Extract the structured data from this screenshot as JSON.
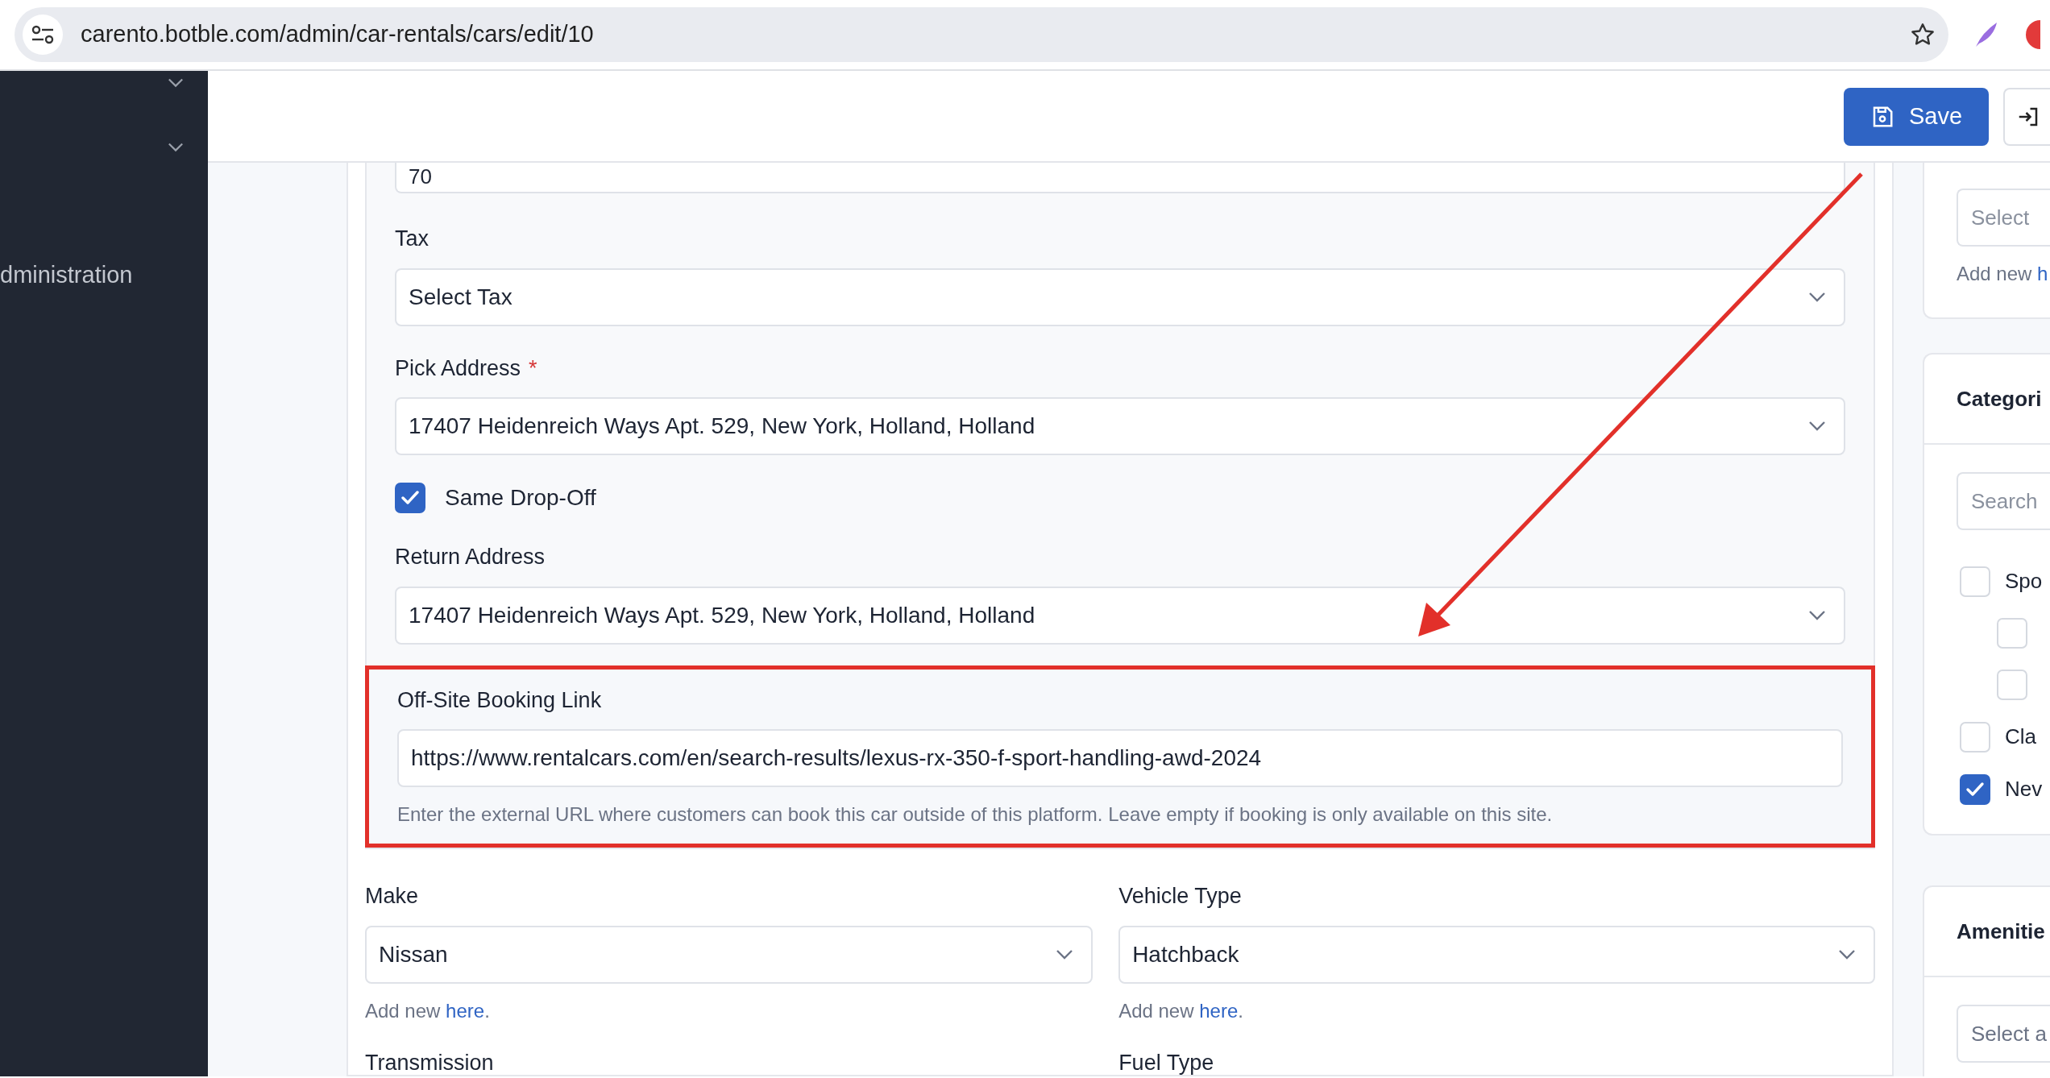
{
  "browser": {
    "url": "carento.botble.com/admin/car-rentals/cars/edit/10"
  },
  "sidebar": {
    "items": [
      {
        "kind": "chevron"
      },
      {
        "kind": "chevron"
      },
      {
        "kind": "label",
        "label": "dministration"
      }
    ]
  },
  "header": {
    "buttons": [
      {
        "kind": "primary",
        "label": "Save"
      },
      {
        "kind": "icon"
      }
    ]
  },
  "form": {
    "top_value": "70",
    "fields": [
      {
        "kind": "select",
        "label": "Tax",
        "value": "Select Tax"
      },
      {
        "kind": "select",
        "label": "Pick Address",
        "value": "17407 Heidenreich Ways Apt. 529, New York, Holland, Holland",
        "required_mark": "*"
      },
      {
        "kind": "checkbox",
        "label": "Same Drop-Off",
        "checked": true
      },
      {
        "kind": "select",
        "label": "Return Address",
        "value": "17407 Heidenreich Ways Apt. 529, New York, Holland, Holland"
      }
    ],
    "highlight": {
      "label": "Off-Site Booking Link",
      "value": "https://www.rentalcars.com/en/search-results/lexus-rx-350-f-sport-handling-awd-2024",
      "help": "Enter the external URL where customers can book this car outside of this platform. Leave empty if booking is only available on this site."
    },
    "columns": [
      {
        "label": "Make",
        "value": "Nissan",
        "help": "Add new ",
        "link": "here",
        "suffix": ".",
        "next_label": "Transmission"
      },
      {
        "label": "Vehicle Type",
        "value": "Hatchback",
        "help": "Add new ",
        "link": "here",
        "suffix": ".",
        "next_label": "Fuel Type"
      }
    ]
  },
  "right_cards": [
    {
      "kind": "select",
      "placeholder": "Select",
      "help": "Add new ",
      "link": "h"
    },
    {
      "kind": "categories",
      "title": "Categori",
      "search_placeholder": "Search",
      "items": [
        {
          "label": "Spo",
          "checked": false,
          "children": [
            {
              "checked": false
            },
            {
              "checked": false
            }
          ]
        },
        {
          "label": "Cla",
          "checked": false
        },
        {
          "label": "Nev",
          "checked": true
        }
      ]
    },
    {
      "kind": "amenities",
      "title": "Amenitie",
      "placeholder": "Select a"
    }
  ],
  "annotations": [
    {
      "kind": "arrow"
    }
  ]
}
